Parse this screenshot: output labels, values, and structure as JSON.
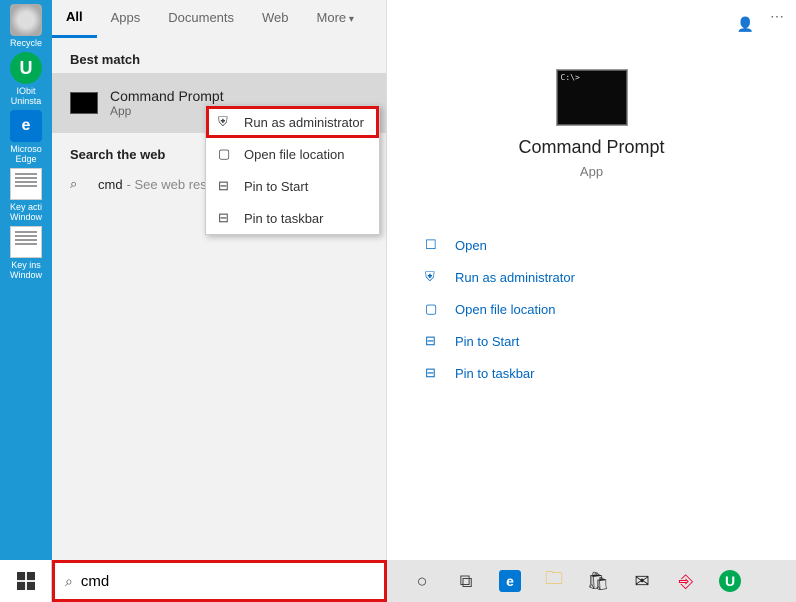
{
  "desktop": {
    "icons": [
      {
        "name": "recycle",
        "label": "Recycle"
      },
      {
        "name": "iobit",
        "label": "IObit Uninsta"
      },
      {
        "name": "edge",
        "label": "Microso Edge"
      },
      {
        "name": "doc1",
        "label": "Key acti Window"
      },
      {
        "name": "doc2",
        "label": "Key ins Window"
      }
    ]
  },
  "tabs": {
    "all": "All",
    "apps": "Apps",
    "documents": "Documents",
    "web": "Web",
    "more": "More"
  },
  "sections": {
    "best_match": "Best match",
    "search_web": "Search the web"
  },
  "best_match": {
    "title": "Command Prompt",
    "subtitle": "App"
  },
  "web_result": {
    "query": "cmd",
    "hint": "- See web resul"
  },
  "context": {
    "run_admin": "Run as administrator",
    "open_loc": "Open file location",
    "pin_start": "Pin to Start",
    "pin_taskbar": "Pin to taskbar"
  },
  "detail": {
    "title": "Command Prompt",
    "subtitle": "App",
    "actions": {
      "open": "Open",
      "run_admin": "Run as administrator",
      "open_loc": "Open file location",
      "pin_start": "Pin to Start",
      "pin_taskbar": "Pin to taskbar"
    }
  },
  "searchbox": {
    "value": "cmd"
  }
}
